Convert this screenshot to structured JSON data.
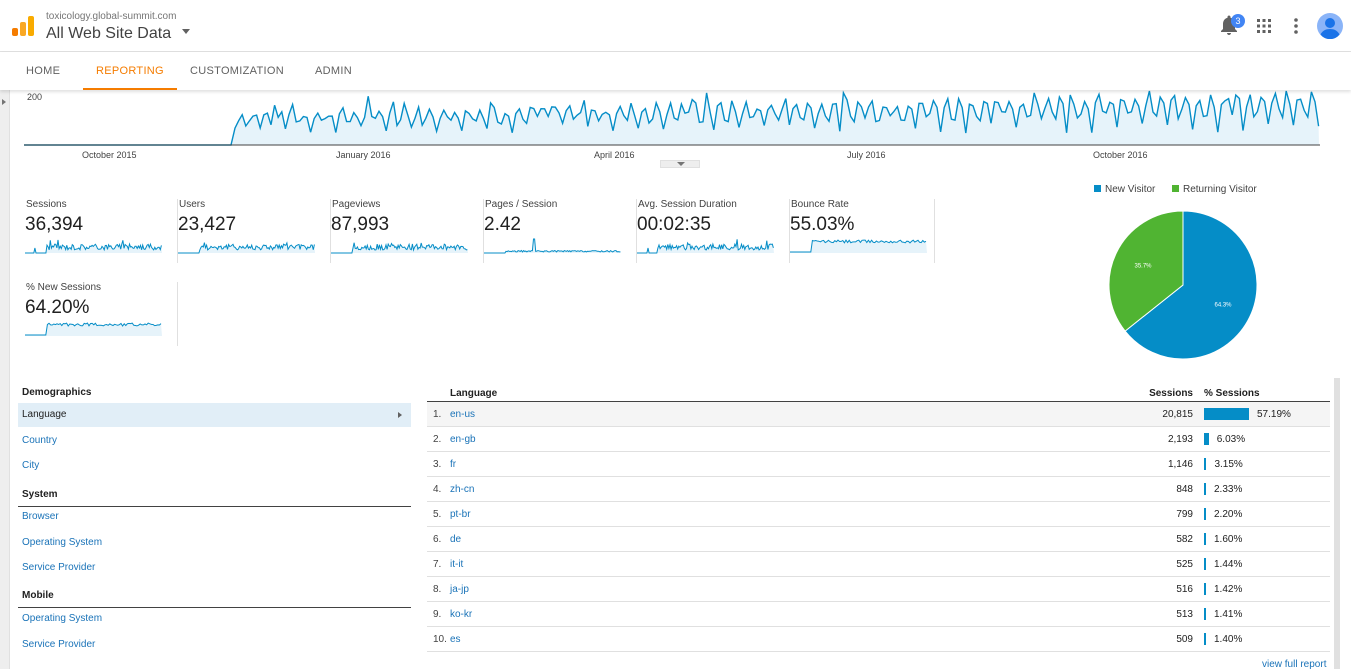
{
  "header": {
    "property_url": "toxicology.global-summit.com",
    "view_title": "All Web Site Data",
    "notification_count": "3"
  },
  "tabs": [
    {
      "label": "HOME"
    },
    {
      "label": "REPORTING",
      "active": true
    },
    {
      "label": "CUSTOMIZATION"
    },
    {
      "label": "ADMIN"
    }
  ],
  "timeline": {
    "y_tick": "200",
    "x_ticks": [
      "October 2015",
      "January 2016",
      "April 2016",
      "July 2016",
      "October 2016"
    ],
    "line_color": "#058dc7",
    "fill_color": "#e6f3fa"
  },
  "metrics": [
    {
      "label": "Sessions",
      "value": "36,394"
    },
    {
      "label": "Users",
      "value": "23,427"
    },
    {
      "label": "Pageviews",
      "value": "87,993"
    },
    {
      "label": "Pages / Session",
      "value": "2.42"
    },
    {
      "label": "Avg. Session Duration",
      "value": "00:02:35"
    },
    {
      "label": "Bounce Rate",
      "value": "55.03%"
    },
    {
      "label": "% New Sessions",
      "value": "64.20%"
    }
  ],
  "chart_data": {
    "type": "pie",
    "legend_position": "top",
    "series": [
      {
        "name": "New Visitor",
        "value": 64.3,
        "label": "64.3%",
        "color": "#058dc7"
      },
      {
        "name": "Returning Visitor",
        "value": 35.7,
        "label": "35.7%",
        "color": "#50b432"
      }
    ]
  },
  "dimensions": {
    "sections": [
      {
        "title": "Demographics",
        "items": [
          "Language",
          "Country",
          "City"
        ]
      },
      {
        "title": "System",
        "items": [
          "Browser",
          "Operating System",
          "Service Provider"
        ]
      },
      {
        "title": "Mobile",
        "items": [
          "Operating System",
          "Service Provider"
        ]
      }
    ],
    "selected": "Language"
  },
  "language_table": {
    "headers": {
      "dimension": "Language",
      "sessions": "Sessions",
      "pct": "% Sessions"
    },
    "rows": [
      {
        "idx": "1.",
        "lang": "en-us",
        "sessions": "20,815",
        "pct": "57.19%",
        "share": 57.19
      },
      {
        "idx": "2.",
        "lang": "en-gb",
        "sessions": "2,193",
        "pct": "6.03%",
        "share": 6.03
      },
      {
        "idx": "3.",
        "lang": "fr",
        "sessions": "1,146",
        "pct": "3.15%",
        "share": 3.15
      },
      {
        "idx": "4.",
        "lang": "zh-cn",
        "sessions": "848",
        "pct": "2.33%",
        "share": 2.33
      },
      {
        "idx": "5.",
        "lang": "pt-br",
        "sessions": "799",
        "pct": "2.20%",
        "share": 2.2
      },
      {
        "idx": "6.",
        "lang": "de",
        "sessions": "582",
        "pct": "1.60%",
        "share": 1.6
      },
      {
        "idx": "7.",
        "lang": "it-it",
        "sessions": "525",
        "pct": "1.44%",
        "share": 1.44
      },
      {
        "idx": "8.",
        "lang": "ja-jp",
        "sessions": "516",
        "pct": "1.42%",
        "share": 1.42
      },
      {
        "idx": "9.",
        "lang": "ko-kr",
        "sessions": "513",
        "pct": "1.41%",
        "share": 1.41
      },
      {
        "idx": "10.",
        "lang": "es",
        "sessions": "509",
        "pct": "1.40%",
        "share": 1.4
      }
    ],
    "view_full_report": "view full report"
  }
}
